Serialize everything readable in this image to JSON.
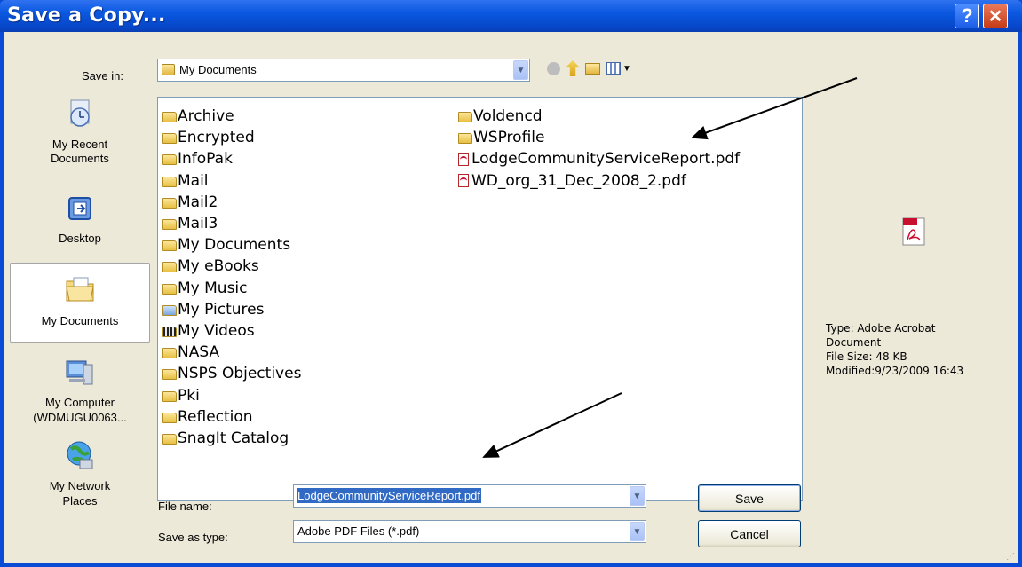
{
  "window": {
    "title": "Save a Copy..."
  },
  "titlebar": {
    "help": "?",
    "close": "✕"
  },
  "save_in": {
    "label": "Save in:",
    "value": "My Documents"
  },
  "places": [
    {
      "label": "My Recent Documents",
      "icon": "recent-documents-icon"
    },
    {
      "label": "Desktop",
      "icon": "desktop-icon"
    },
    {
      "label": "My Documents",
      "icon": "my-documents-icon"
    },
    {
      "label": "My Computer (WDMUGU0063...",
      "icon": "my-computer-icon"
    },
    {
      "label": "My Network Places",
      "icon": "network-places-icon"
    }
  ],
  "files_col1": [
    {
      "name": "Archive",
      "type": "folder"
    },
    {
      "name": "Encrypted",
      "type": "folder"
    },
    {
      "name": "InfoPak",
      "type": "folder"
    },
    {
      "name": "Mail",
      "type": "folder"
    },
    {
      "name": "Mail2",
      "type": "folder"
    },
    {
      "name": "Mail3",
      "type": "folder"
    },
    {
      "name": "My Documents",
      "type": "folder"
    },
    {
      "name": "My eBooks",
      "type": "folder"
    },
    {
      "name": "My Music",
      "type": "music-folder"
    },
    {
      "name": "My Pictures",
      "type": "pictures-folder"
    },
    {
      "name": "My Videos",
      "type": "videos-folder"
    },
    {
      "name": "NASA",
      "type": "folder"
    },
    {
      "name": "NSPS Objectives",
      "type": "folder"
    },
    {
      "name": "Pki",
      "type": "folder"
    },
    {
      "name": "Reflection",
      "type": "folder"
    },
    {
      "name": "SnagIt Catalog",
      "type": "folder"
    }
  ],
  "files_col2": [
    {
      "name": "Voldencd",
      "type": "folder"
    },
    {
      "name": "WSProfile",
      "type": "folder"
    },
    {
      "name": "LodgeCommunityServiceReport.pdf",
      "type": "pdf"
    },
    {
      "name": "WD_org_31_Dec_2008_2.pdf",
      "type": "pdf"
    }
  ],
  "preview": {
    "type": "Type: Adobe Acrobat Document",
    "size": "File Size: 48 KB",
    "modified": "Modified:9/23/2009 16:43"
  },
  "file_name": {
    "label": "File name:",
    "value": "LodgeCommunityServiceReport.pdf"
  },
  "save_type": {
    "label": "Save as type:",
    "value": "Adobe PDF Files (*.pdf)"
  },
  "buttons": {
    "save": "Save",
    "cancel": "Cancel"
  },
  "colors": {
    "title_bar": "#0a58e0",
    "dialog_bg": "#ece9d8",
    "selection": "#316ac5"
  }
}
